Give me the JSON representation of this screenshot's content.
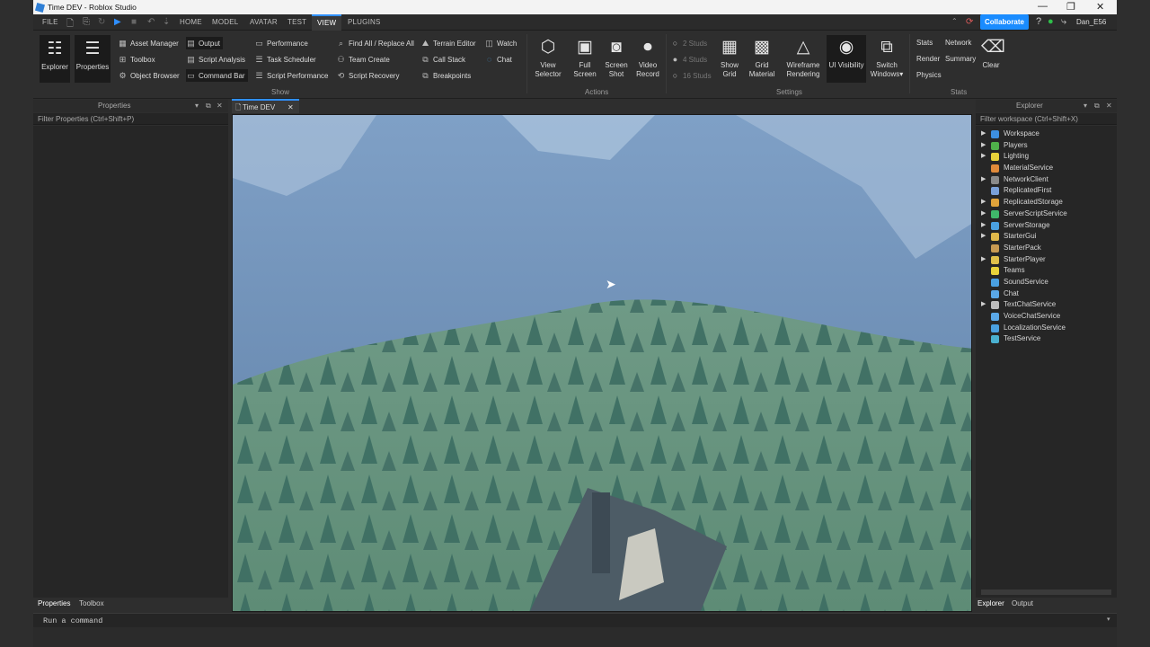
{
  "window": {
    "title": "Time DEV - Roblox Studio"
  },
  "menu": {
    "file": "FILE",
    "tabs": [
      "HOME",
      "MODEL",
      "AVATAR",
      "TEST",
      "VIEW",
      "PLUGINS"
    ],
    "active": "VIEW"
  },
  "header": {
    "collaborate": "Collaborate",
    "user": "Dan_E56"
  },
  "ribbon": {
    "big_explorer": "Explorer",
    "big_properties": "Properties",
    "asset_manager": "Asset Manager",
    "toolbox": "Toolbox",
    "object_browser": "Object Browser",
    "output": "Output",
    "script_analysis": "Script Analysis",
    "command_bar": "Command Bar",
    "performance": "Performance",
    "task_scheduler": "Task Scheduler",
    "script_performance": "Script Performance",
    "find_replace": "Find All / Replace All",
    "team_create": "Team Create",
    "script_recovery": "Script Recovery",
    "terrain_editor": "Terrain Editor",
    "call_stack": "Call Stack",
    "breakpoints": "Breakpoints",
    "watch": "Watch",
    "chat": "Chat",
    "group_show": "Show",
    "view_selector_1": "View",
    "view_selector_2": "Selector",
    "full_screen_1": "Full",
    "full_screen_2": "Screen",
    "screen_shot_1": "Screen",
    "screen_shot_2": "Shot",
    "video_record_1": "Video",
    "video_record_2": "Record",
    "group_actions": "Actions",
    "studs_2": "2 Studs",
    "studs_4": "4 Studs",
    "studs_16": "16 Studs",
    "show_grid_1": "Show",
    "show_grid_2": "Grid",
    "grid_material_1": "Grid",
    "grid_material_2": "Material",
    "wireframe_1": "Wireframe",
    "wireframe_2": "Rendering",
    "ui_visibility": "UI Visibility",
    "switch_windows_1": "Switch",
    "switch_windows_2": "Windows",
    "group_settings": "Settings",
    "stats": "Stats",
    "network": "Network",
    "render": "Render",
    "summary": "Summary",
    "physics": "Physics",
    "clear": "Clear",
    "group_stats": "Stats"
  },
  "properties": {
    "title": "Properties",
    "filter": "Filter Properties (Ctrl+Shift+P)"
  },
  "document": {
    "tab": "Time DEV"
  },
  "explorer": {
    "title": "Explorer",
    "filter": "Filter workspace (Ctrl+Shift+X)",
    "items": [
      {
        "label": "Workspace",
        "expandable": true,
        "color": "#3d8fe0"
      },
      {
        "label": "Players",
        "expandable": true,
        "color": "#4fb04a"
      },
      {
        "label": "Lighting",
        "expandable": true,
        "color": "#e8d23a"
      },
      {
        "label": "MaterialService",
        "expandable": false,
        "color": "#e08a3a"
      },
      {
        "label": "NetworkClient",
        "expandable": true,
        "color": "#8a8a8a"
      },
      {
        "label": "ReplicatedFirst",
        "expandable": false,
        "color": "#7aa0d8"
      },
      {
        "label": "ReplicatedStorage",
        "expandable": true,
        "color": "#e0a23a"
      },
      {
        "label": "ServerScriptService",
        "expandable": true,
        "color": "#3fb86a"
      },
      {
        "label": "ServerStorage",
        "expandable": true,
        "color": "#4aa0e0"
      },
      {
        "label": "StarterGui",
        "expandable": true,
        "color": "#e0b84a"
      },
      {
        "label": "StarterPack",
        "expandable": false,
        "color": "#c89a52"
      },
      {
        "label": "StarterPlayer",
        "expandable": true,
        "color": "#e0c04a"
      },
      {
        "label": "Teams",
        "expandable": false,
        "color": "#e8d23a"
      },
      {
        "label": "SoundService",
        "expandable": false,
        "color": "#4aa0e0"
      },
      {
        "label": "Chat",
        "expandable": false,
        "color": "#5aa8e8"
      },
      {
        "label": "TextChatService",
        "expandable": true,
        "color": "#bdbdbd"
      },
      {
        "label": "VoiceChatService",
        "expandable": false,
        "color": "#5aa8e8"
      },
      {
        "label": "LocalizationService",
        "expandable": false,
        "color": "#4aa0e0"
      },
      {
        "label": "TestService",
        "expandable": false,
        "color": "#4ab0d0"
      }
    ]
  },
  "bottom_tabs": {
    "properties": "Properties",
    "toolbox": "Toolbox",
    "explorer": "Explorer",
    "output": "Output"
  },
  "command_bar": {
    "placeholder": "Run a command"
  }
}
